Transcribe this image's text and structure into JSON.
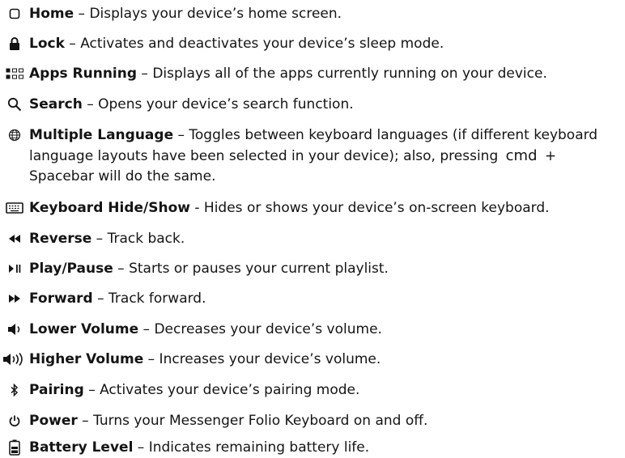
{
  "items": [
    {
      "icon": "home-square-icon",
      "term": "Home",
      "desc": " – Displays your device’s home screen."
    },
    {
      "icon": "lock-icon",
      "term": "Lock",
      "desc": " – Activates and deactivates your device’s sleep mode."
    },
    {
      "icon": "apps-grid-icon",
      "term": "Apps Running",
      "desc": " – Displays all of the apps currently running on your device."
    },
    {
      "icon": "search-icon",
      "term": "Search",
      "desc": " – Opens your device’s search function."
    },
    {
      "icon": "globe-icon",
      "term": "Multiple Language",
      "desc": " – Toggles between keyboard languages (if different keyboard language layouts have been selected in your device); also, pressing ",
      "cmd": "cmd",
      "desc2": " + Spacebar will do the same."
    },
    {
      "icon": "keyboard-icon",
      "term": "Keyboard Hide/Show",
      "desc": " - Hides or shows your device’s on-screen keyboard."
    },
    {
      "icon": "rewind-icon",
      "term": "Reverse",
      "desc": " – Track back."
    },
    {
      "icon": "play-pause-icon",
      "term": "Play/Pause",
      "desc": " – Starts or pauses your current playlist."
    },
    {
      "icon": "fast-forward-icon",
      "term": "Forward",
      "desc": " – Track forward."
    },
    {
      "icon": "volume-low-icon",
      "term": "Lower Volume",
      "desc": " – Decreases your device’s volume."
    },
    {
      "icon": "volume-high-icon",
      "term": "Higher Volume",
      "desc": " – Increases your device’s volume."
    },
    {
      "icon": "bluetooth-icon",
      "term": "Pairing",
      "desc": " – Activates your device’s pairing mode."
    },
    {
      "icon": "power-icon",
      "term": "Power",
      "desc": " – Turns your Messenger Folio Keyboard on and off."
    },
    {
      "icon": "battery-icon",
      "term": "Battery Level",
      "desc": " – Indicates remaining battery life."
    }
  ]
}
